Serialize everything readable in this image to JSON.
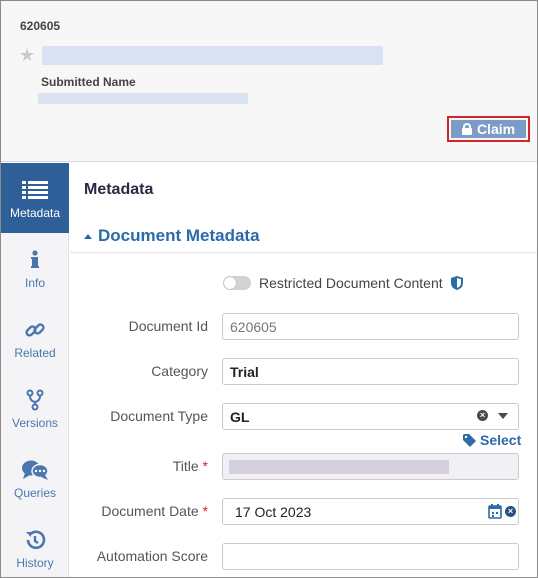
{
  "header": {
    "document_id": "620605",
    "submitted_name_label": "Submitted Name",
    "claim_label": "Claim"
  },
  "sidebar": {
    "items": [
      {
        "label": "Metadata",
        "icon": "list-icon",
        "active": true
      },
      {
        "label": "Info",
        "icon": "info-icon",
        "active": false
      },
      {
        "label": "Related",
        "icon": "link-icon",
        "active": false
      },
      {
        "label": "Versions",
        "icon": "branch-icon",
        "active": false
      },
      {
        "label": "Queries",
        "icon": "chat-icon",
        "active": false
      },
      {
        "label": "History",
        "icon": "history-icon",
        "active": false
      }
    ]
  },
  "main": {
    "title": "Metadata",
    "section_title": "Document Metadata",
    "restricted_label": "Restricted Document Content",
    "fields": {
      "document_id": {
        "label": "Document Id",
        "value": "620605"
      },
      "category": {
        "label": "Category",
        "value": "Trial"
      },
      "document_type": {
        "label": "Document Type",
        "value": "GL"
      },
      "title": {
        "label": "Title",
        "required": "*"
      },
      "document_date": {
        "label": "Document Date",
        "value": "17 Oct 2023",
        "required": "*"
      },
      "automation_score": {
        "label": "Automation Score",
        "value": ""
      }
    },
    "select_link": "Select"
  },
  "colors": {
    "accent": "#2d6aa8",
    "active_sidebar": "#2f5f98",
    "claim_button": "#7a9cc6",
    "highlight_border": "#d0262b"
  }
}
